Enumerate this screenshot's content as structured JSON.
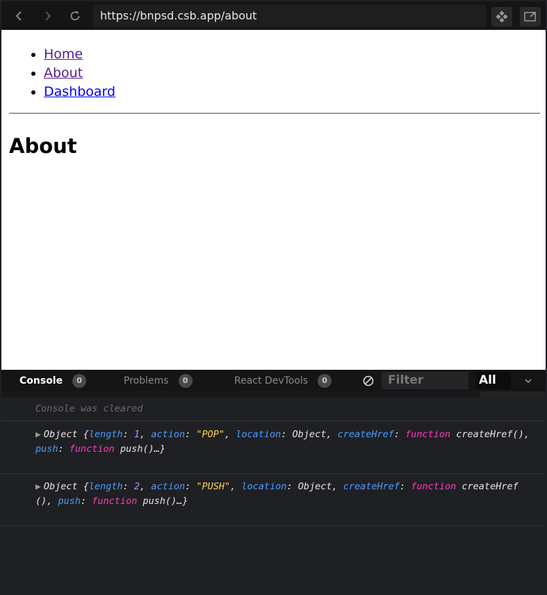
{
  "browser": {
    "url": "https://bnpsd.csb.app/about",
    "back_icon": "chevron-left-icon",
    "forward_icon": "chevron-right-icon",
    "reload_icon": "reload-icon",
    "codesandbox_icon": "codesandbox-icon",
    "open_new_window_icon": "external-window-icon"
  },
  "page": {
    "nav": [
      {
        "label": "Home",
        "visited": true
      },
      {
        "label": "About",
        "visited": true
      },
      {
        "label": "Dashboard",
        "visited": false
      }
    ],
    "title": "About"
  },
  "devtools": {
    "tabs": [
      {
        "label": "Console",
        "count": "0",
        "active": true
      },
      {
        "label": "Problems",
        "count": "0",
        "active": false
      },
      {
        "label": "React DevTools",
        "count": "0",
        "active": false
      }
    ],
    "filter_placeholder": "Filter",
    "level": "All",
    "console": {
      "cleared_message": "Console was cleared",
      "logs": [
        {
          "prefix": "Object {",
          "parts": [
            {
              "t": "length",
              "c": "k"
            },
            {
              "t": ": ",
              "c": "p"
            },
            {
              "t": "1",
              "c": "n"
            },
            {
              "t": ", ",
              "c": "p"
            },
            {
              "t": "action",
              "c": "k"
            },
            {
              "t": ": ",
              "c": "p"
            },
            {
              "t": "\"POP\"",
              "c": "s"
            },
            {
              "t": ", ",
              "c": "p"
            },
            {
              "t": "location",
              "c": "k"
            },
            {
              "t": ": Object, ",
              "c": "p"
            },
            {
              "t": "createHref",
              "c": "k"
            },
            {
              "t": ": ",
              "c": "p"
            },
            {
              "t": "function",
              "c": "f"
            },
            {
              "t": " createHref(), ",
              "c": "p"
            },
            {
              "t": "push",
              "c": "k"
            },
            {
              "t": ": ",
              "c": "p"
            },
            {
              "t": "function",
              "c": "f"
            },
            {
              "t": " push()…}",
              "c": "p"
            }
          ]
        },
        {
          "prefix": "Object {",
          "parts": [
            {
              "t": "length",
              "c": "k"
            },
            {
              "t": ": ",
              "c": "p"
            },
            {
              "t": "2",
              "c": "n"
            },
            {
              "t": ", ",
              "c": "p"
            },
            {
              "t": "action",
              "c": "k"
            },
            {
              "t": ": ",
              "c": "p"
            },
            {
              "t": "\"PUSH\"",
              "c": "s"
            },
            {
              "t": ", ",
              "c": "p"
            },
            {
              "t": "location",
              "c": "k"
            },
            {
              "t": ": Object, ",
              "c": "p"
            },
            {
              "t": "createHref",
              "c": "k"
            },
            {
              "t": ": ",
              "c": "p"
            },
            {
              "t": "function",
              "c": "f"
            },
            {
              "t": " createHref (), ",
              "c": "p"
            },
            {
              "t": "push",
              "c": "k"
            },
            {
              "t": ": ",
              "c": "p"
            },
            {
              "t": "function",
              "c": "f"
            },
            {
              "t": " push()…}",
              "c": "p"
            }
          ]
        }
      ]
    }
  },
  "colors": {
    "key": "#4b9eff",
    "number": "#b78cff",
    "string": "#ffd54a",
    "function": "#ff3cbe",
    "visited_link": "#551a8b",
    "link": "#0000ee"
  }
}
